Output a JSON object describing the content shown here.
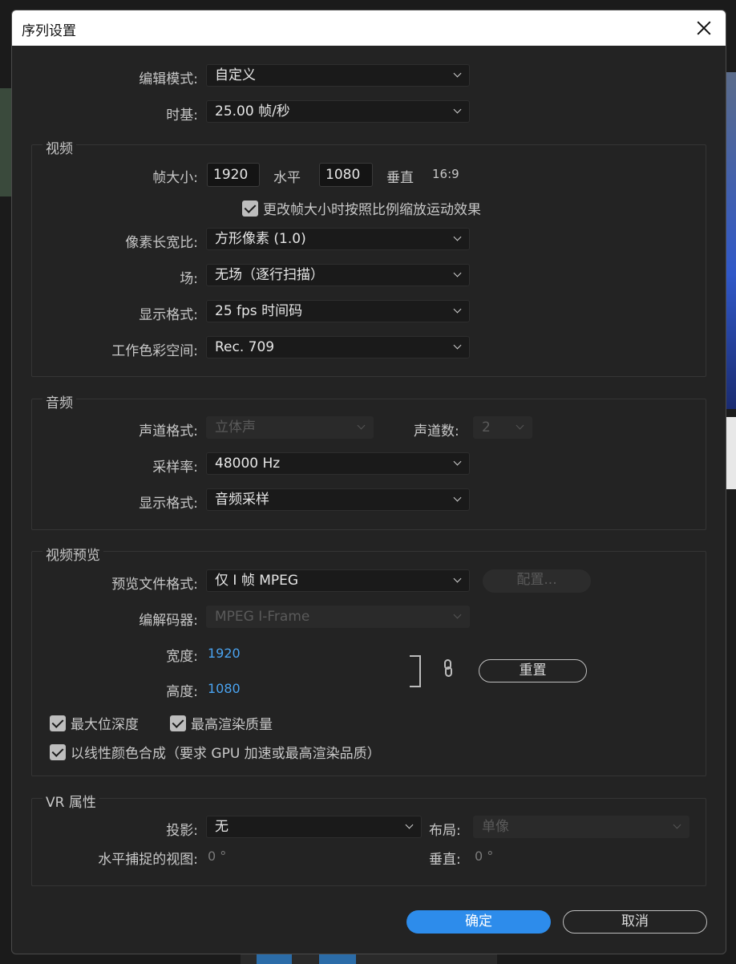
{
  "title": "序列设置",
  "top": {
    "edit_mode_label": "编辑模式:",
    "edit_mode_value": "自定义",
    "timebase_label": "时基:",
    "timebase_value": "25.00  帧/秒"
  },
  "video": {
    "group_title": "视频",
    "frame_size_label": "帧大小:",
    "width_value": "1920",
    "horizontal_label": "水平",
    "height_value": "1080",
    "vertical_label": "垂直",
    "aspect": "16:9",
    "scale_checkbox_label": "更改帧大小时按照比例缩放运动效果",
    "pixel_aspect_label": "像素长宽比:",
    "pixel_aspect_value": "方形像素 (1.0)",
    "fields_label": "场:",
    "fields_value": "无场（逐行扫描）",
    "display_format_label": "显示格式:",
    "display_format_value": "25 fps 时间码",
    "color_space_label": "工作色彩空间:",
    "color_space_value": "Rec. 709"
  },
  "audio": {
    "group_title": "音频",
    "channel_format_label": "声道格式:",
    "channel_format_value": "立体声",
    "channel_count_label": "声道数:",
    "channel_count_value": "2",
    "sample_rate_label": "采样率:",
    "sample_rate_value": "48000 Hz",
    "display_format_label": "显示格式:",
    "display_format_value": "音频采样"
  },
  "preview": {
    "group_title": "视频预览",
    "file_format_label": "预览文件格式:",
    "file_format_value": "仅 I 帧 MPEG",
    "configure_label": "配置...",
    "codec_label": "编解码器:",
    "codec_value": "MPEG I-Frame",
    "width_label": "宽度:",
    "width_value": "1920",
    "height_label": "高度:",
    "height_value": "1080",
    "reset_label": "重置",
    "max_bit_depth_label": "最大位深度",
    "max_render_quality_label": "最高渲染质量",
    "linear_color_label": "以线性颜色合成（要求 GPU 加速或最高渲染品质）"
  },
  "vr": {
    "group_title": "VR 属性",
    "projection_label": "投影:",
    "projection_value": "无",
    "layout_label": "布局:",
    "layout_value": "单像",
    "h_view_label": "水平捕捉的视图:",
    "h_view_value": "0 °",
    "v_label": "垂直:",
    "v_value": "0 °"
  },
  "buttons": {
    "ok_label": "确定",
    "cancel_label": "取消"
  },
  "colors": {
    "accent": "#2d8ceb",
    "value_blue": "#4aa3f0"
  }
}
